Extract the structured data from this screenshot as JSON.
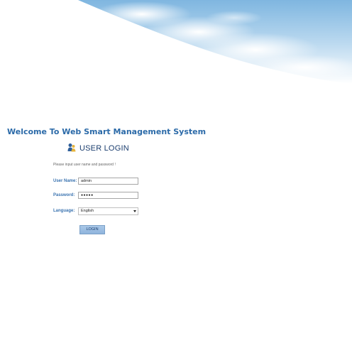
{
  "header": {
    "title": "Welcome To Web Smart Management System"
  },
  "login": {
    "heading": "USER LOGIN",
    "prompt": "Please input user name and password !",
    "username_label": "User Name:",
    "username_value": "admin",
    "password_label": "Password:",
    "password_value": "●●●●●",
    "language_label": "Language:",
    "language_value": "English",
    "submit_label": "LOGIN"
  },
  "icons": {
    "user": "user-icon",
    "dropdown": "chevron-down-icon"
  },
  "colors": {
    "title": "#2b6aa8",
    "label": "#3a73b0",
    "button_bg": "#9cbde2"
  }
}
